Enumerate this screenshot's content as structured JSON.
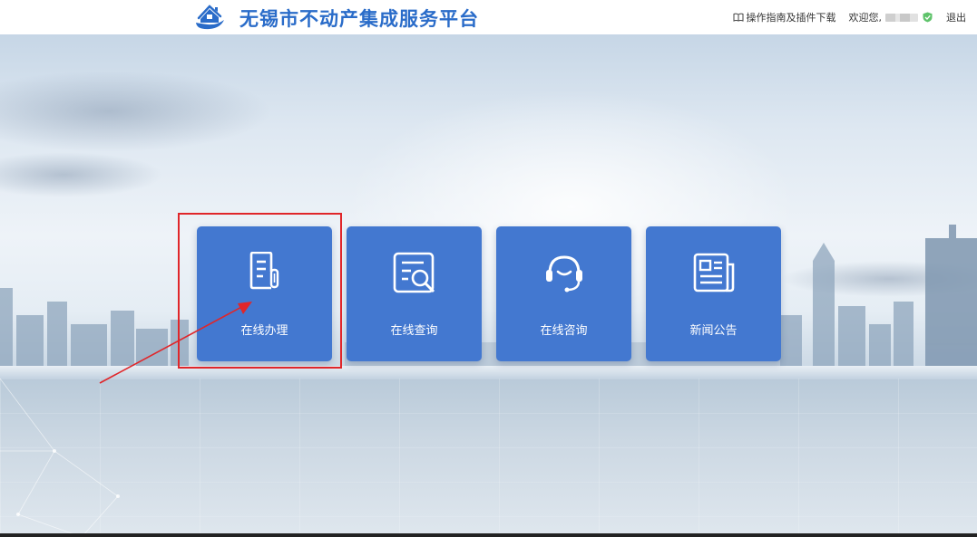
{
  "header": {
    "site_title": "无锡市不动产集成服务平台",
    "guide_link": "操作指南及插件下载",
    "welcome_text": "欢迎您,",
    "logout_label": "退出",
    "logo_icon": "house-logo-icon",
    "guide_icon": "book-icon",
    "verified_icon": "shield-check-icon"
  },
  "tiles": [
    {
      "label": "在线办理",
      "icon": "document-edit-icon"
    },
    {
      "label": "在线查询",
      "icon": "document-search-icon"
    },
    {
      "label": "在线咨询",
      "icon": "headset-icon"
    },
    {
      "label": "新闻公告",
      "icon": "newspaper-icon"
    }
  ],
  "annotation": {
    "highlight_color": "#e0262a",
    "highlighted_tile": "在线办理"
  },
  "colors": {
    "brand": "#2a6cc9",
    "tile_bg": "#4378d0"
  }
}
